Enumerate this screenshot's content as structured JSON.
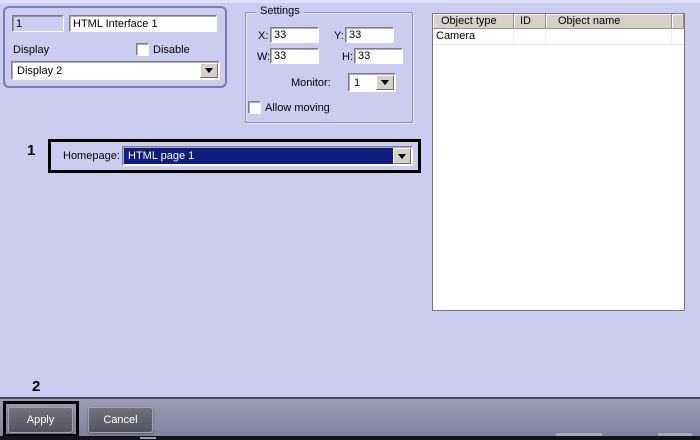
{
  "colors": {
    "background": "#ccccf0",
    "panel_border": "#7b7bb6",
    "selection_navy": "#111d7d",
    "table_header_bg": "#d5d1c9",
    "footer_bar": "#8d8da9",
    "annotation": "#000000"
  },
  "icons": {
    "dropdown_arrow": "css-triangle-down"
  },
  "id_panel": {
    "id_value": "1",
    "name_value": "HTML Interface 1",
    "display_label": "Display",
    "disable_label": "Disable",
    "display_select_value": "Display 2"
  },
  "settings": {
    "title": "Settings",
    "x_label": "X:",
    "x_value": "33",
    "y_label": "Y:",
    "y_value": "33",
    "w_label": "W:",
    "w_value": "33",
    "h_label": "H:",
    "h_value": "33",
    "monitor_label": "Monitor:",
    "monitor_value": "1",
    "allow_moving_label": "Allow moving"
  },
  "homepage": {
    "annotation_number": "1",
    "label": "Homepage:",
    "selected_value": "HTML page 1"
  },
  "object_table": {
    "columns": [
      "Object type",
      "ID",
      "Object name"
    ],
    "rows": [
      {
        "type": "Camera",
        "id": "",
        "name": ""
      }
    ]
  },
  "footer": {
    "annotation_number": "2",
    "apply_label": "Apply",
    "cancel_label": "Cancel"
  }
}
